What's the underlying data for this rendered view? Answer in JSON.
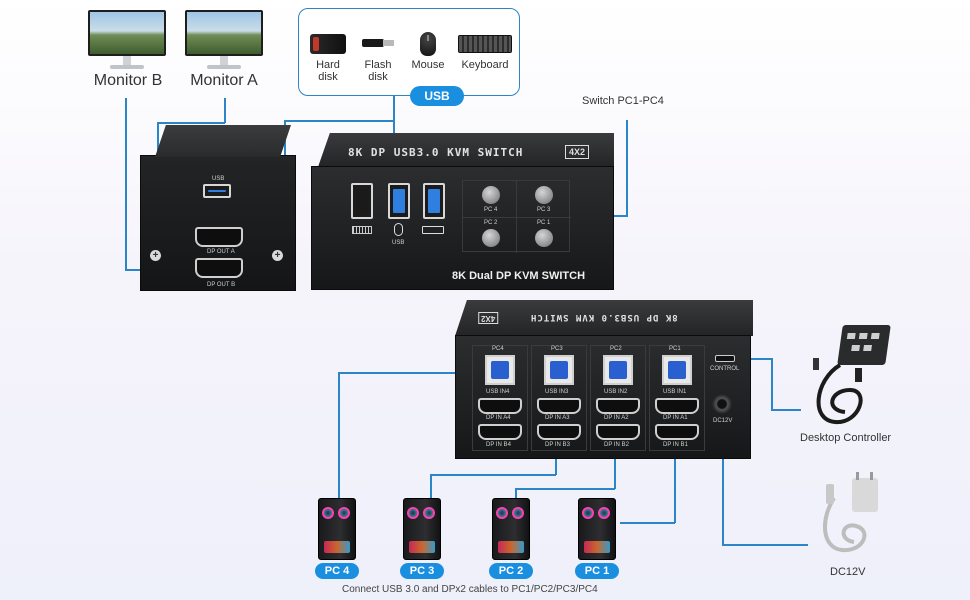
{
  "monitors": [
    {
      "label": "Monitor B"
    },
    {
      "label": "Monitor A"
    }
  ],
  "usb_devices": [
    {
      "icon": "hard-disk-icon",
      "label_line1": "Hard",
      "label_line2": "disk"
    },
    {
      "icon": "flash-disk-icon",
      "label_line1": "Flash",
      "label_line2": "disk"
    },
    {
      "icon": "mouse-icon",
      "label_line1": "Mouse",
      "label_line2": ""
    },
    {
      "icon": "keyboard-icon",
      "label_line1": "Keyboard",
      "label_line2": ""
    }
  ],
  "usb_pill": "USB",
  "switch_label": "Switch PC1-PC4",
  "front_panel": {
    "title": "8K DP USB3.0 KVM SWITCH",
    "badge": "4X2",
    "brand_text": "8K Dual DP KVM SWITCH",
    "usb_label": "USB",
    "buttons": [
      "PC 4",
      "PC 3",
      "PC 2",
      "PC 1"
    ]
  },
  "side_panel": {
    "usb_label": "USB",
    "dp_out_a": "DP OUT A",
    "dp_out_b": "DP OUT B"
  },
  "back_panel": {
    "title": "8K DP USB3.0 KVM SWITCH",
    "badge": "4X2",
    "columns": [
      {
        "pc": "PC4",
        "usb": "USB IN4",
        "dp_a": "DP IN A4",
        "dp_b": "DP IN B4"
      },
      {
        "pc": "PC3",
        "usb": "USB IN3",
        "dp_a": "DP IN A3",
        "dp_b": "DP IN B3"
      },
      {
        "pc": "PC2",
        "usb": "USB IN2",
        "dp_a": "DP IN A2",
        "dp_b": "DP IN B2"
      },
      {
        "pc": "PC1",
        "usb": "USB IN1",
        "dp_a": "DP IN A1",
        "dp_b": "DP IN B1"
      }
    ],
    "control_label": "CONTROL",
    "dc_label": "DC12V"
  },
  "desktop_controller_label": "Desktop Controller",
  "power_label": "DC12V",
  "pcs": [
    {
      "label": "PC 4"
    },
    {
      "label": "PC 3"
    },
    {
      "label": "PC 2"
    },
    {
      "label": "PC 1"
    }
  ],
  "caption": "Connect USB 3.0 and DPx2 cables to PC1/PC2/PC3/PC4",
  "colors": {
    "accent": "#1a8fe0",
    "line": "#2a86c8",
    "device": "#1e1f21"
  }
}
